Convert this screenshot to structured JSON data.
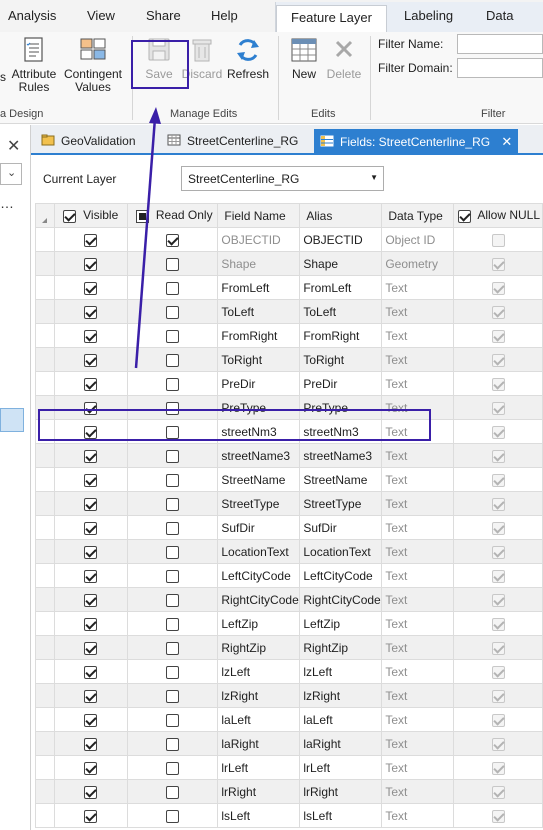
{
  "ribbon_tabs": [
    "Analysis",
    "View",
    "Share",
    "Help"
  ],
  "context_tabs": [
    "Feature Layer",
    "Labeling",
    "Data"
  ],
  "ribbon": {
    "data_design": {
      "buttons": [
        {
          "label": "Attribute\nRules",
          "icon": "attribute-rules-icon"
        },
        {
          "label": "Contingent\nValues",
          "icon": "contingent-values-icon"
        }
      ],
      "group_label": "a Design",
      "partial_letter": "s"
    },
    "manage_edits": {
      "save": "Save",
      "discard": "Discard",
      "refresh": "Refresh",
      "group_label": "Manage Edits"
    },
    "edits": {
      "new": "New",
      "delete": "Delete",
      "group_label": "Edits"
    },
    "filter": {
      "name_label": "Filter Name:",
      "domain_label": "Filter Domain:",
      "group_label": "Filter"
    }
  },
  "doc_tabs": [
    {
      "label": "GeoValidation",
      "icon": "catalog-icon",
      "active": false
    },
    {
      "label": "StreetCenterline_RG",
      "icon": "table-icon",
      "active": false
    },
    {
      "label": "Fields: StreetCenterline_RG",
      "icon": "fields-icon",
      "active": true
    }
  ],
  "current_layer": {
    "label": "Current Layer",
    "value": "StreetCenterline_RG"
  },
  "grid": {
    "columns": [
      "Visible",
      "Read Only",
      "Field Name",
      "Alias",
      "Data Type",
      "Allow NULL"
    ],
    "rows": [
      {
        "name": "OBJECTID",
        "alias": "OBJECTID",
        "type": "Object ID",
        "visible": true,
        "readonly": true,
        "allownull": false,
        "system": true
      },
      {
        "name": "Shape",
        "alias": "Shape",
        "type": "Geometry",
        "visible": true,
        "readonly": false,
        "allownull": true,
        "system": true
      },
      {
        "name": "FromLeft",
        "alias": "FromLeft",
        "type": "Text",
        "visible": true,
        "readonly": false,
        "allownull": true
      },
      {
        "name": "ToLeft",
        "alias": "ToLeft",
        "type": "Text",
        "visible": true,
        "readonly": false,
        "allownull": true
      },
      {
        "name": "FromRight",
        "alias": "FromRight",
        "type": "Text",
        "visible": true,
        "readonly": false,
        "allownull": true
      },
      {
        "name": "ToRight",
        "alias": "ToRight",
        "type": "Text",
        "visible": true,
        "readonly": false,
        "allownull": true
      },
      {
        "name": "PreDir",
        "alias": "PreDir",
        "type": "Text",
        "visible": true,
        "readonly": false,
        "allownull": true
      },
      {
        "name": "PreType",
        "alias": "PreType",
        "type": "Text",
        "visible": true,
        "readonly": false,
        "allownull": true
      },
      {
        "name": "streetNm3",
        "alias": "streetNm3",
        "type": "Text",
        "visible": true,
        "readonly": false,
        "allownull": true
      },
      {
        "name": "streetName3",
        "alias": "streetName3",
        "type": "Text",
        "visible": true,
        "readonly": false,
        "allownull": true
      },
      {
        "name": "StreetName",
        "alias": "StreetName",
        "type": "Text",
        "visible": true,
        "readonly": false,
        "allownull": true
      },
      {
        "name": "StreetType",
        "alias": "StreetType",
        "type": "Text",
        "visible": true,
        "readonly": false,
        "allownull": true
      },
      {
        "name": "SufDir",
        "alias": "SufDir",
        "type": "Text",
        "visible": true,
        "readonly": false,
        "allownull": true
      },
      {
        "name": "LocationText",
        "alias": "LocationText",
        "type": "Text",
        "visible": true,
        "readonly": false,
        "allownull": true
      },
      {
        "name": "LeftCityCode",
        "alias": "LeftCityCode",
        "type": "Text",
        "visible": true,
        "readonly": false,
        "allownull": true
      },
      {
        "name": "RightCityCode",
        "alias": "RightCityCode",
        "type": "Text",
        "visible": true,
        "readonly": false,
        "allownull": true
      },
      {
        "name": "LeftZip",
        "alias": "LeftZip",
        "type": "Text",
        "visible": true,
        "readonly": false,
        "allownull": true
      },
      {
        "name": "RightZip",
        "alias": "RightZip",
        "type": "Text",
        "visible": true,
        "readonly": false,
        "allownull": true
      },
      {
        "name": "lzLeft",
        "alias": "lzLeft",
        "type": "Text",
        "visible": true,
        "readonly": false,
        "allownull": true
      },
      {
        "name": "lzRight",
        "alias": "lzRight",
        "type": "Text",
        "visible": true,
        "readonly": false,
        "allownull": true
      },
      {
        "name": "laLeft",
        "alias": "laLeft",
        "type": "Text",
        "visible": true,
        "readonly": false,
        "allownull": true
      },
      {
        "name": "laRight",
        "alias": "laRight",
        "type": "Text",
        "visible": true,
        "readonly": false,
        "allownull": true
      },
      {
        "name": "lrLeft",
        "alias": "lrLeft",
        "type": "Text",
        "visible": true,
        "readonly": false,
        "allownull": true
      },
      {
        "name": "lrRight",
        "alias": "lrRight",
        "type": "Text",
        "visible": true,
        "readonly": false,
        "allownull": true
      },
      {
        "name": "lsLeft",
        "alias": "lsLeft",
        "type": "Text",
        "visible": true,
        "readonly": false,
        "allownull": true
      }
    ]
  },
  "colors": {
    "accent": "#2d7fd0",
    "annotation": "#3a1fa8"
  }
}
